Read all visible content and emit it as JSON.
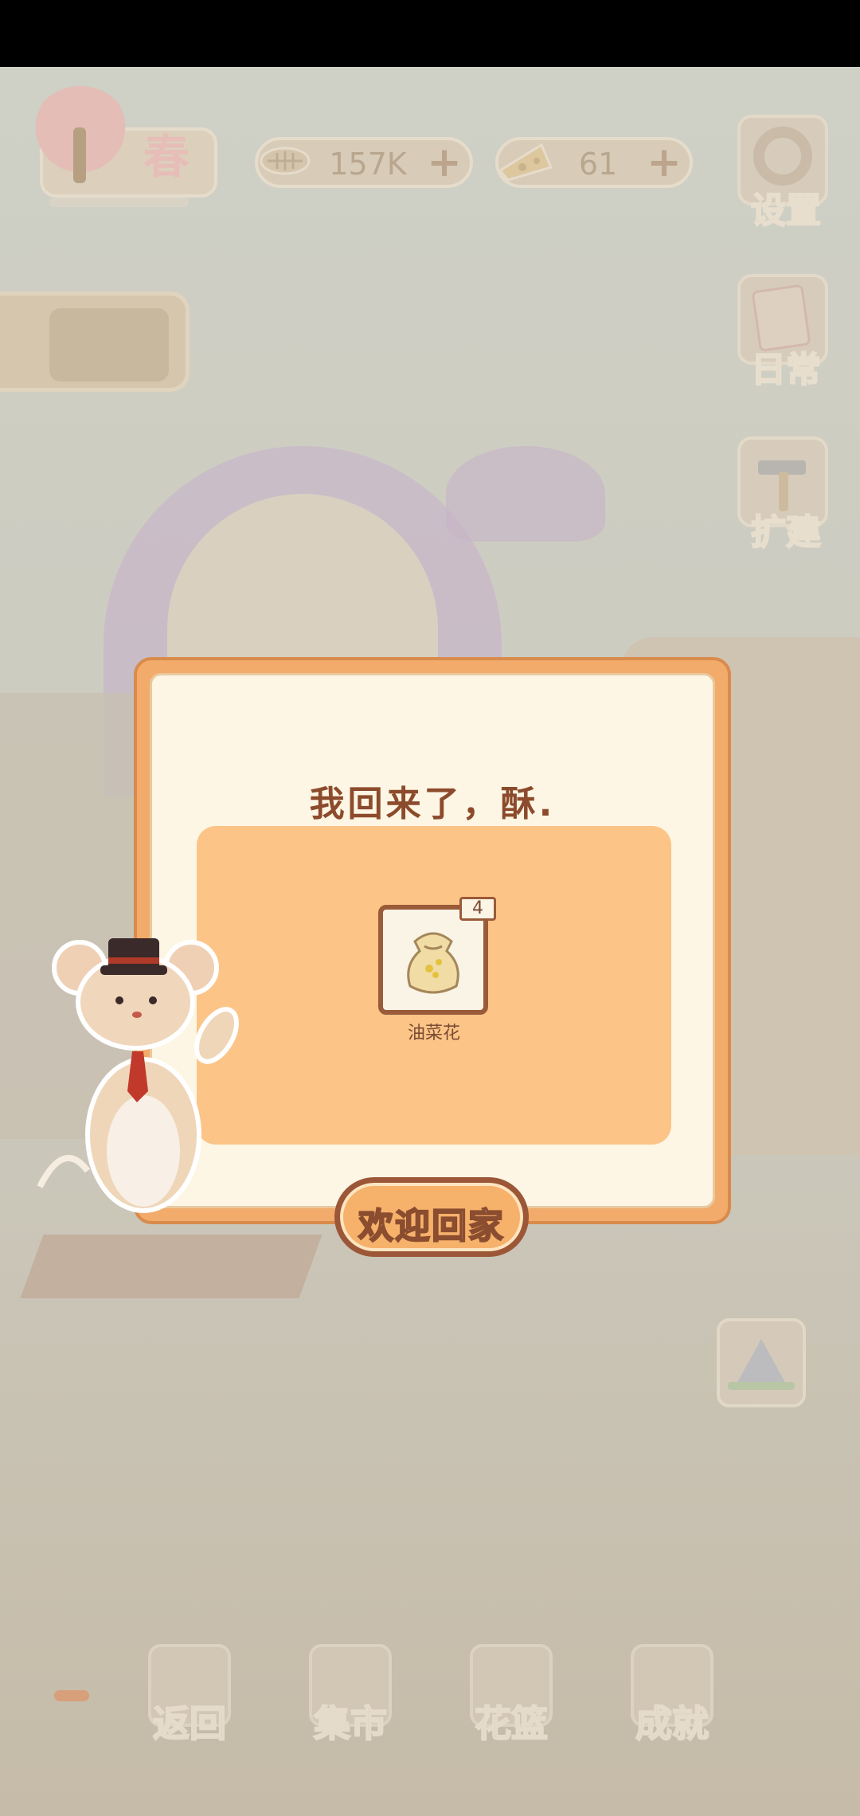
{
  "hud": {
    "season_label": "春",
    "fish_value": "157K",
    "cheese_value": "61",
    "plus_symbol": "+"
  },
  "side_menu": {
    "settings_label": "设置",
    "daily_label": "日常",
    "expand_label": "扩建"
  },
  "dialog": {
    "title": "我回来了，酥.",
    "reward": {
      "name": "油菜花",
      "count": "4"
    },
    "confirm_label": "欢迎回家"
  },
  "bottom_nav": {
    "items": [
      {
        "label": "返回"
      },
      {
        "label": "集市"
      },
      {
        "label": "花篮"
      },
      {
        "label": "成就"
      }
    ]
  },
  "colors": {
    "dialog_border": "#f2ab6b",
    "dialog_bg": "#fdf6e4",
    "reward_panel": "#fcc487",
    "title_text": "#8c4b2c"
  }
}
